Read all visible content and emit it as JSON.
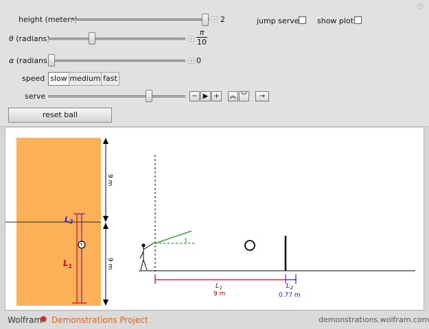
{
  "controls": {
    "height": {
      "label": "height (meters)",
      "value": "2"
    },
    "theta": {
      "label_prefix": "θ",
      "label_suffix": " (radians)",
      "value_num": "π",
      "value_den": "10"
    },
    "alpha": {
      "label_prefix": "α",
      "label_suffix": " (radians)",
      "value": "0"
    },
    "speed": {
      "label": "speed",
      "options": [
        "slow",
        "medium",
        "fast"
      ],
      "selected": "slow"
    },
    "serve": {
      "label": "serve"
    },
    "jump_serve": {
      "label": "jump serve",
      "checked": false
    },
    "show_plot": {
      "label": "show plot",
      "checked": false
    },
    "reset": {
      "label": "reset ball"
    }
  },
  "court_view": {
    "top_dim": "9 m",
    "bottom_dim": "9 m",
    "L2": "L",
    "L2_sub": "2",
    "L1": "L",
    "L1_sub": "1"
  },
  "side_view": {
    "L1": "L",
    "L1_sub": "1",
    "L1_value": "9 m",
    "L2": "L",
    "L2_sub": "2",
    "L2_value": "0.77 m"
  },
  "footer": {
    "brand": "Wolfram",
    "project": "Demonstrations Project",
    "site": "demonstrations.wolfram.com"
  },
  "colors": {
    "court": "#fbb157",
    "red": "#e8001a",
    "purple": "#7a1aa0",
    "blue": "#2020c8",
    "green": "#1d9a1d",
    "brand_orange": "#e0631c"
  }
}
